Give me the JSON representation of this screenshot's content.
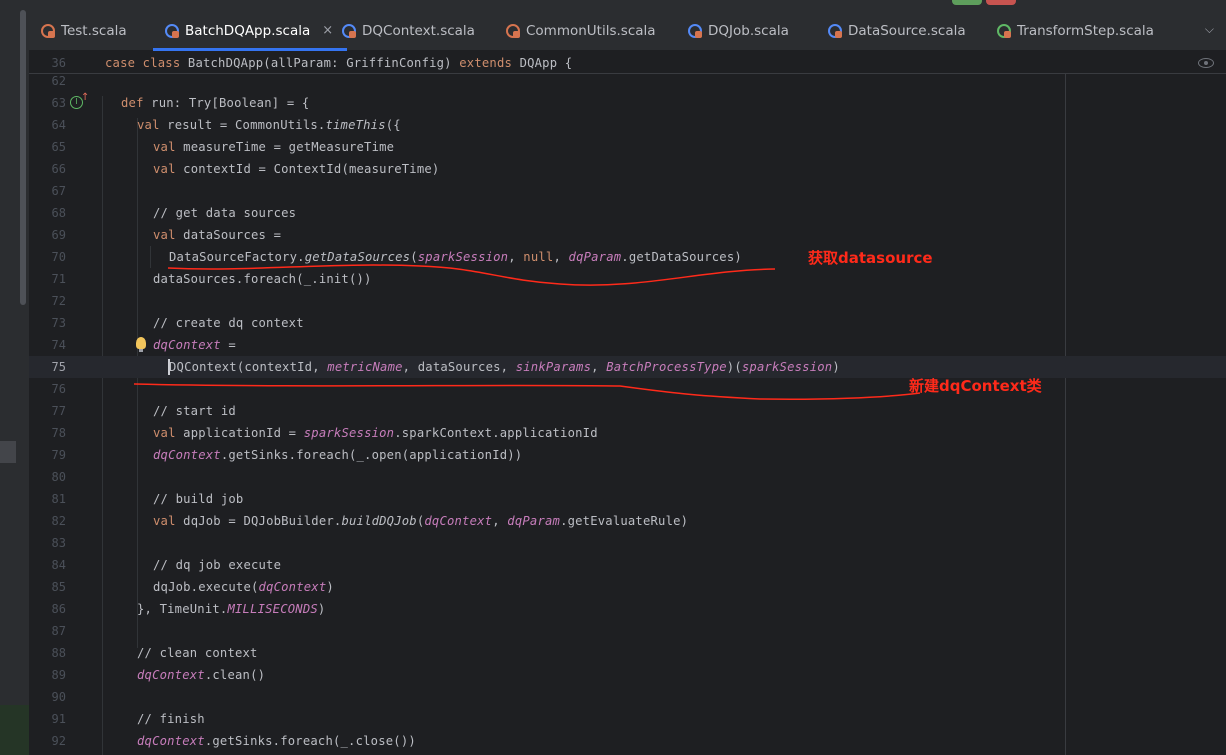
{
  "tabs": [
    {
      "label": "Test.scala",
      "icon": "scala-object-icon",
      "active": false
    },
    {
      "label": "BatchDQApp.scala",
      "icon": "scala-class-icon",
      "active": true,
      "close": "×"
    },
    {
      "label": "DQContext.scala",
      "icon": "scala-class-icon",
      "active": false
    },
    {
      "label": "CommonUtils.scala",
      "icon": "scala-object-icon",
      "active": false
    },
    {
      "label": "DQJob.scala",
      "icon": "scala-class-icon",
      "active": false
    },
    {
      "label": "DataSource.scala",
      "icon": "scala-class-icon",
      "active": false
    },
    {
      "label": "TransformStep.scala",
      "icon": "scala-trait-icon",
      "active": false
    }
  ],
  "sticky": {
    "num": "36"
  },
  "lines": [
    {
      "num": "62"
    },
    {
      "num": "63"
    },
    {
      "num": "64"
    },
    {
      "num": "65"
    },
    {
      "num": "66"
    },
    {
      "num": "67"
    },
    {
      "num": "68"
    },
    {
      "num": "69"
    },
    {
      "num": "70"
    },
    {
      "num": "71"
    },
    {
      "num": "72"
    },
    {
      "num": "73"
    },
    {
      "num": "74"
    },
    {
      "num": "75"
    },
    {
      "num": "76"
    },
    {
      "num": "77"
    },
    {
      "num": "78"
    },
    {
      "num": "79"
    },
    {
      "num": "80"
    },
    {
      "num": "81"
    },
    {
      "num": "82"
    },
    {
      "num": "83"
    },
    {
      "num": "84"
    },
    {
      "num": "85"
    },
    {
      "num": "86"
    },
    {
      "num": "87"
    },
    {
      "num": "88"
    },
    {
      "num": "89"
    },
    {
      "num": "90"
    },
    {
      "num": "91"
    },
    {
      "num": "92"
    }
  ],
  "annotations": {
    "datasource": "获取datasource",
    "dqcontext": "新建dqContext类"
  },
  "colors": {
    "annotation": "#ff2a1a",
    "active_tab_underline": "#3574f0",
    "keyword": "#cf8e6d",
    "comment": "#7a7e85",
    "member": "#c77dbb"
  }
}
